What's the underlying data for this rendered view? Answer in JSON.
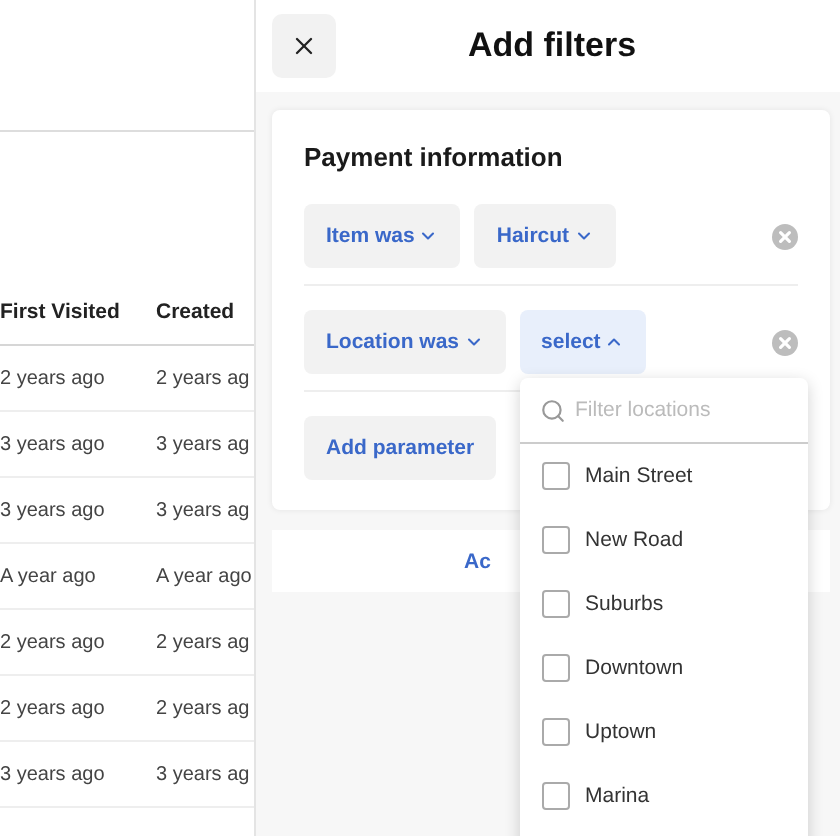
{
  "table": {
    "columns": [
      "First Visited",
      "Created"
    ],
    "rows": [
      [
        "2 years ago",
        "2 years ag"
      ],
      [
        "3 years ago",
        "3 years ag"
      ],
      [
        "3 years ago",
        "3 years ag"
      ],
      [
        "A year ago",
        "A year ago"
      ],
      [
        "2 years ago",
        "2 years ag"
      ],
      [
        "2 years ago",
        "2 years ag"
      ],
      [
        "3 years ago",
        "3 years ag"
      ]
    ]
  },
  "panel": {
    "title": "Add filters",
    "section": {
      "title": "Payment information",
      "filters": [
        {
          "chips": [
            {
              "label": "Item was",
              "open": false
            },
            {
              "label": "Haircut",
              "open": false
            }
          ]
        },
        {
          "chips": [
            {
              "label": "Location was",
              "open": false
            },
            {
              "label": "select",
              "open": true
            }
          ]
        }
      ],
      "add_button": "Add parameter"
    },
    "footer_button": "Ac"
  },
  "dropdown": {
    "placeholder": "Filter locations",
    "options": [
      {
        "label": "Main Street",
        "checked": false
      },
      {
        "label": "New Road",
        "checked": false
      },
      {
        "label": "Suburbs",
        "checked": false
      },
      {
        "label": "Downtown",
        "checked": false
      },
      {
        "label": "Uptown",
        "checked": false
      },
      {
        "label": "Marina",
        "checked": false
      }
    ]
  }
}
